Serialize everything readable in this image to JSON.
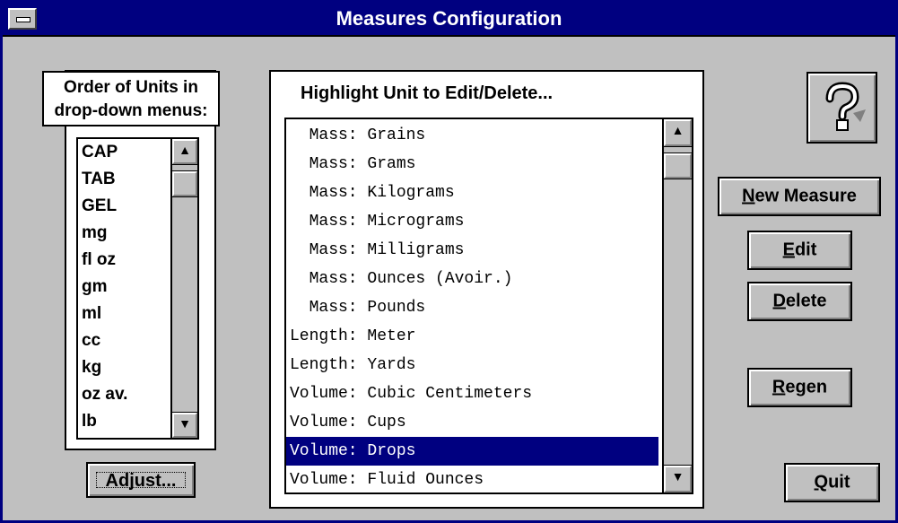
{
  "window": {
    "title": "Measures Configuration"
  },
  "order_panel": {
    "label_line1": "Order of Units in",
    "label_line2": "drop-down menus:",
    "units": [
      "CAP",
      "TAB",
      "GEL",
      "mg",
      "fl oz",
      "gm",
      "ml",
      "cc",
      "kg",
      "oz av.",
      "lb"
    ],
    "adjust_label": "Adjust..."
  },
  "measures_panel": {
    "label": "Highlight Unit to Edit/Delete...",
    "items": [
      "  Mass: Grains",
      "  Mass: Grams",
      "  Mass: Kilograms",
      "  Mass: Micrograms",
      "  Mass: Milligrams",
      "  Mass: Ounces (Avoir.)",
      "  Mass: Pounds",
      "Length: Meter",
      "Length: Yards",
      "Volume: Cubic Centimeters",
      "Volume: Cups",
      "Volume: Drops",
      "Volume: Fluid Ounces"
    ],
    "selected_index": 11
  },
  "buttons": {
    "new_measure": {
      "mnemonic": "N",
      "rest": "ew Measure"
    },
    "edit": {
      "mnemonic": "E",
      "rest": "dit"
    },
    "delete": {
      "mnemonic": "D",
      "rest": "elete"
    },
    "regen": {
      "mnemonic": "R",
      "rest": "egen"
    },
    "quit": {
      "mnemonic": "Q",
      "rest": "uit"
    }
  },
  "icons": {
    "help": "help-question-icon",
    "up": "scroll-up-arrow-icon",
    "down": "scroll-down-arrow-icon",
    "sysmenu": "system-menu-icon"
  },
  "colors": {
    "titlebar": "#000080",
    "selection": "#000080",
    "face": "#c0c0c0"
  }
}
